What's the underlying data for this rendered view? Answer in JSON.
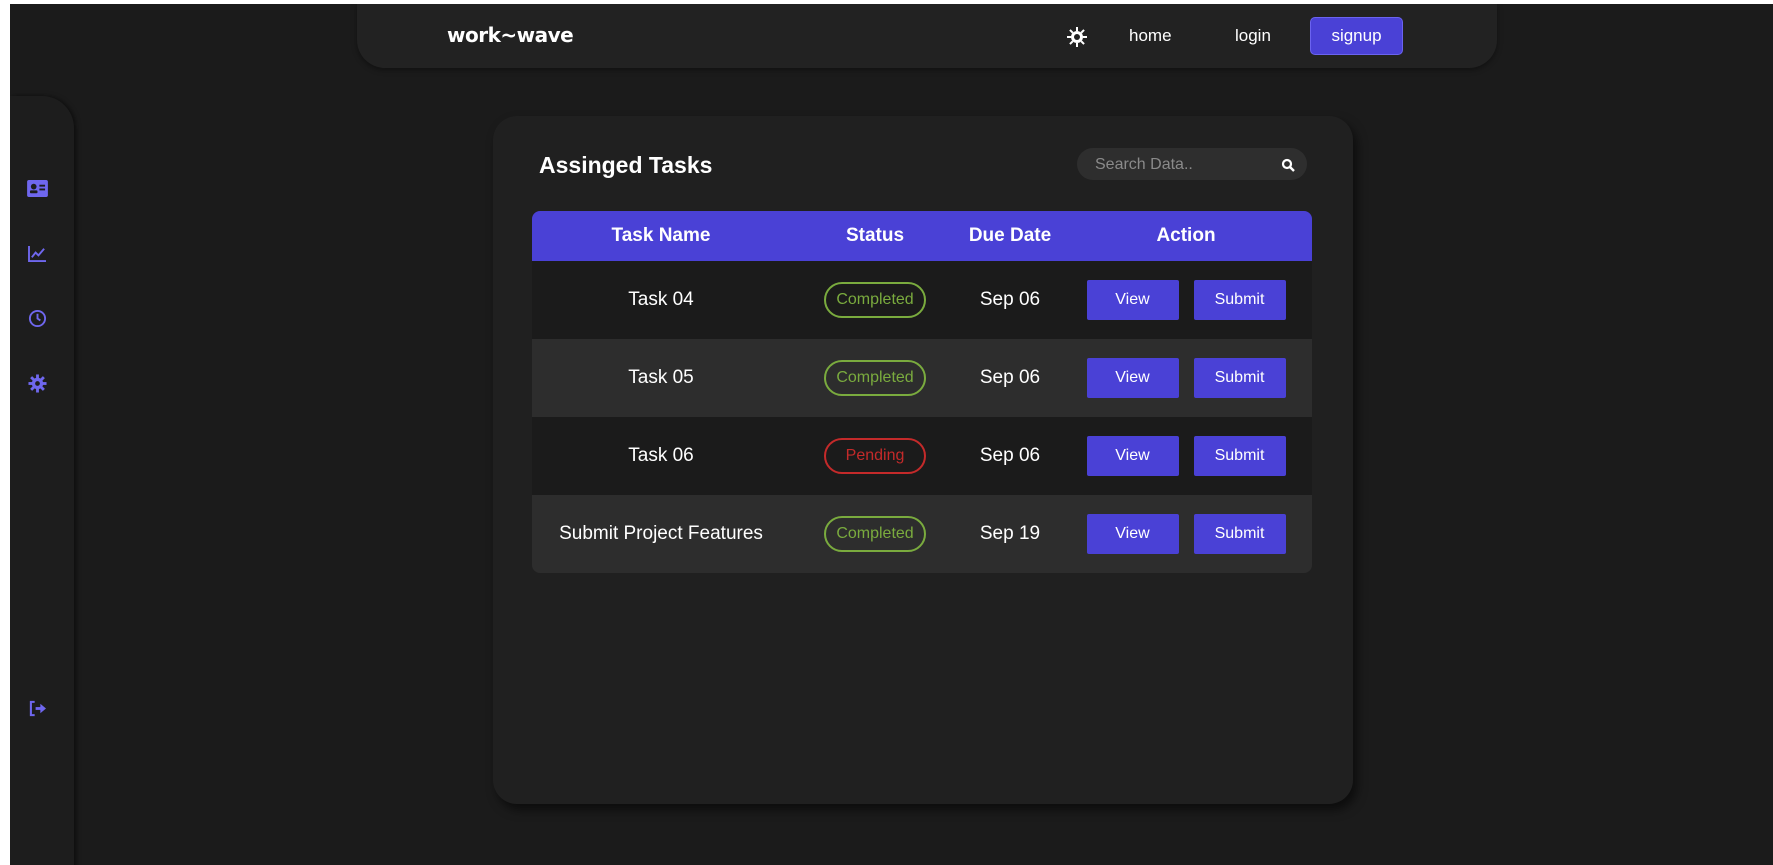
{
  "nav": {
    "logo": "work~wave",
    "links": {
      "home": "home",
      "login": "login",
      "signup": "signup"
    },
    "theme_icon": "sun-gear-icon"
  },
  "sidebar": {
    "items": [
      {
        "icon": "id-card-icon"
      },
      {
        "icon": "chart-line-icon"
      },
      {
        "icon": "clock-icon"
      },
      {
        "icon": "gear-icon"
      }
    ],
    "logout_icon": "sign-out-icon"
  },
  "main": {
    "title": "Assinged Tasks",
    "search": {
      "placeholder": "Search Data..",
      "value": ""
    },
    "table": {
      "headers": [
        "Task Name",
        "Status",
        "Due Date",
        "Action"
      ],
      "rows": [
        {
          "name": "Task 04",
          "status": "Completed",
          "due": "Sep 06",
          "view": "View",
          "submit": "Submit"
        },
        {
          "name": "Task 05",
          "status": "Completed",
          "due": "Sep 06",
          "view": "View",
          "submit": "Submit"
        },
        {
          "name": "Task 06",
          "status": "Pending",
          "due": "Sep 06",
          "view": "View",
          "submit": "Submit"
        },
        {
          "name": "Submit Project Features",
          "status": "Completed",
          "due": "Sep 19",
          "view": "View",
          "submit": "Submit"
        }
      ]
    }
  },
  "colors": {
    "accent": "#4a41d6",
    "completed": "#7aab3e",
    "pending": "#c42a2a",
    "background": "#1b1b1b"
  }
}
